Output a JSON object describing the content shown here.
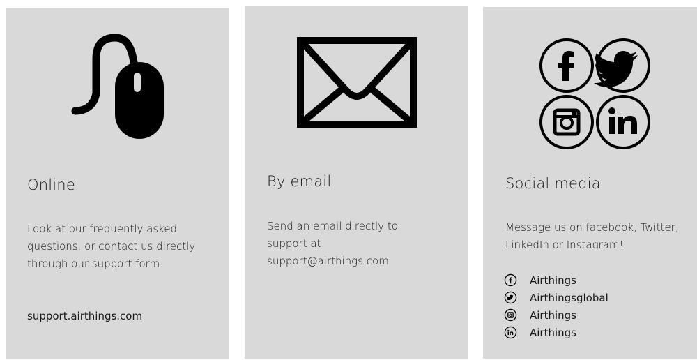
{
  "cards": {
    "online": {
      "title": "Online",
      "description": "Look at our frequently asked questions, or contact us directly through our support form.",
      "link": "support.airthings.com",
      "icon": "mouse-icon"
    },
    "email": {
      "title": "By email",
      "description": "Send an email directly to support at support@airthings.com",
      "icon": "envelope-icon"
    },
    "social": {
      "title": "Social media",
      "description": "Message us on facebook, Twitter, LinkedIn or Instagram!",
      "icon": "social-media-icons",
      "accounts": [
        {
          "network": "facebook",
          "icon": "facebook-icon",
          "handle": "Airthings"
        },
        {
          "network": "twitter",
          "icon": "twitter-icon",
          "handle": "Airthingsglobal"
        },
        {
          "network": "instagram",
          "icon": "instagram-icon",
          "handle": "Airthings"
        },
        {
          "network": "linkedin",
          "icon": "linkedin-icon",
          "handle": "Airthings"
        }
      ]
    }
  },
  "colors": {
    "card_background": "#d9d9d9",
    "page_background": "#ffffff",
    "icon": "#000000",
    "text": "#1a1a1a"
  }
}
